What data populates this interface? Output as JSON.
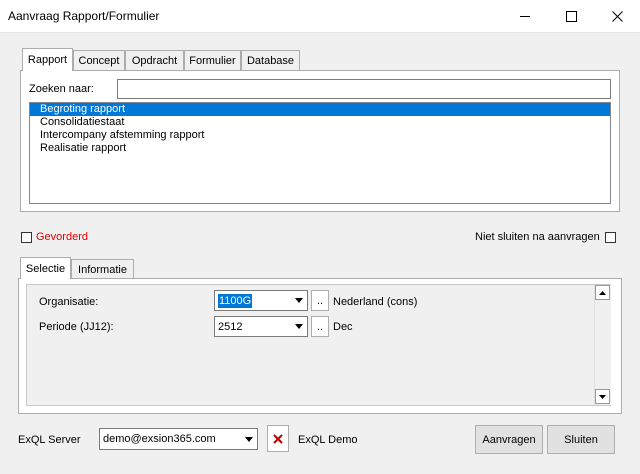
{
  "window": {
    "title": "Aanvraag Rapport/Formulier"
  },
  "tabs": [
    {
      "label": "Rapport",
      "active": true
    },
    {
      "label": "Concept",
      "active": false
    },
    {
      "label": "Opdracht",
      "active": false
    },
    {
      "label": "Formulier",
      "active": false
    },
    {
      "label": "Database",
      "active": false
    }
  ],
  "search": {
    "label": "Zoeken naar:",
    "value": ""
  },
  "report_list": [
    {
      "label": "Begroting rapport",
      "selected": true
    },
    {
      "label": "Consolidatiestaat",
      "selected": false
    },
    {
      "label": "Intercompany afstemming rapport",
      "selected": false
    },
    {
      "label": "Realisatie rapport",
      "selected": false
    }
  ],
  "options": {
    "advanced_label": "Gevorderd",
    "advanced_color": "#e00000",
    "keep_open_label": "Niet sluiten na aanvragen"
  },
  "subtabs": [
    {
      "label": "Selectie",
      "active": true
    },
    {
      "label": "Informatie",
      "active": false
    }
  ],
  "selection": {
    "organisation": {
      "label": "Organisatie:",
      "value": "1100G",
      "browse_label": "..",
      "description": "Nederland (cons)"
    },
    "period": {
      "label": "Periode (JJ12):",
      "value": "2512",
      "browse_label": "..",
      "description": "Dec"
    }
  },
  "footer": {
    "server_label": "ExQL Server",
    "server_value": "demo@exsion365.com",
    "server_name": "ExQL Demo",
    "request_button": "Aanvragen",
    "close_button": "Sluiten"
  },
  "colors": {
    "selection": "#0078d7",
    "delete_icon": "#c00000"
  }
}
